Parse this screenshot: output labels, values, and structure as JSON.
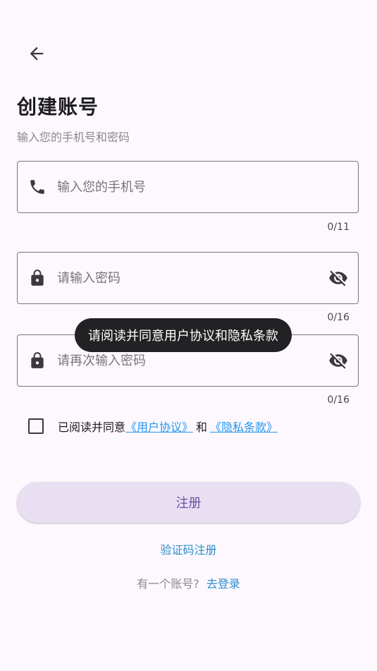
{
  "header": {
    "title": "创建账号",
    "subtitle": "输入您的手机号和密码"
  },
  "form": {
    "phone": {
      "placeholder": "输入您的手机号",
      "value": "",
      "counter": "0/11",
      "icon": "phone-icon"
    },
    "password": {
      "placeholder": "请输入密码",
      "value": "",
      "counter": "0/16",
      "icon": "lock-icon",
      "toggle_icon": "visibility-off-icon"
    },
    "confirm_password": {
      "placeholder": "请再次输入密码",
      "value": "",
      "counter": "0/16",
      "icon": "lock-icon",
      "toggle_icon": "visibility-off-icon"
    }
  },
  "toast": {
    "message": "请阅读并同意用户协议和隐私条款"
  },
  "agreement": {
    "checked": false,
    "prefix": "已阅读并同意",
    "user_agreement": "《用户协议》",
    "conjunction": "和",
    "privacy_policy": "《隐私条款》"
  },
  "actions": {
    "register_label": "注册",
    "sms_register_label": "验证码注册",
    "has_account_text": "有一个账号?",
    "login_label": "去登录"
  },
  "colors": {
    "background": "#fdf8fd",
    "primary": "#6750a4",
    "primary_container": "#e8e0f2",
    "link": "#2196f3",
    "toast_bg": "#222124"
  }
}
